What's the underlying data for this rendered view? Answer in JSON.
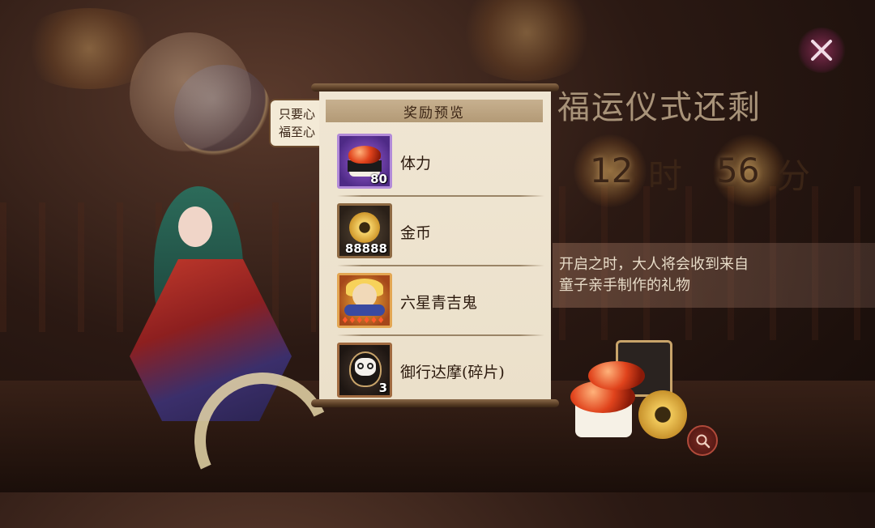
{
  "speech_bubble": {
    "line1": "只要心",
    "line2": "福至心"
  },
  "event": {
    "title": "福运仪式还剩",
    "countdown": {
      "hours": "12",
      "hours_unit": "时",
      "minutes": "56",
      "minutes_unit": "分"
    },
    "description_line1": "开启之时，大人将会收到来自",
    "description_line2": "童子亲手制作的礼物"
  },
  "popup": {
    "title": "奖励预览",
    "rewards": [
      {
        "name": "体力",
        "quantity": "80",
        "icon": "sushi-icon",
        "frame_color": "#9c5fd6"
      },
      {
        "name": "金币",
        "quantity": "88888",
        "icon": "gold-coin-icon",
        "frame_color": "#5a4a38"
      },
      {
        "name": "六星青吉鬼",
        "quantity": "",
        "icon": "shikigami-portrait-icon",
        "frame_color": "#f2b53a"
      },
      {
        "name": "御行达摩(碎片)",
        "quantity": "3",
        "icon": "daruma-icon",
        "frame_color": "#4a3a30"
      }
    ]
  },
  "buttons": {
    "close_icon": "close-icon",
    "preview_icon": "magnifier-icon"
  }
}
